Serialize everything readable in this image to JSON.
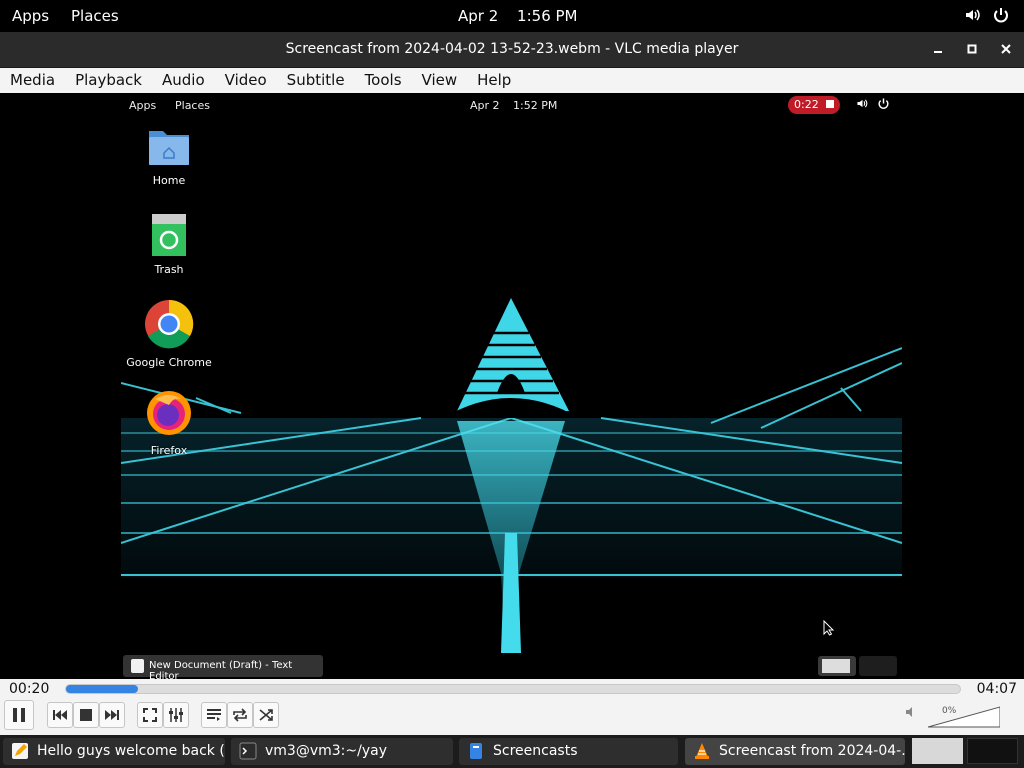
{
  "system_bar": {
    "apps": "Apps",
    "places": "Places",
    "date": "Apr 2",
    "time": "1:56 PM"
  },
  "window": {
    "title": "Screencast from 2024-04-02 13-52-23.webm - VLC media player"
  },
  "menu": [
    "Media",
    "Playback",
    "Audio",
    "Video",
    "Subtitle",
    "Tools",
    "View",
    "Help"
  ],
  "video_frame": {
    "topbar": {
      "apps": "Apps",
      "places": "Places",
      "date": "Apr 2",
      "time": "1:52 PM",
      "recording": "0:22"
    },
    "desktop_icons": [
      {
        "label": "Home",
        "icon": "home-folder-icon"
      },
      {
        "label": "Trash",
        "icon": "trash-icon"
      },
      {
        "label": "Google Chrome",
        "icon": "chrome-icon"
      },
      {
        "label": "Firefox",
        "icon": "firefox-icon"
      }
    ],
    "taskbar_item": "New Document (Draft) - Text Editor"
  },
  "player": {
    "elapsed": "00:20",
    "total": "04:07",
    "progress": 0.081,
    "volume": "0%"
  },
  "taskbar": [
    {
      "label": "Hello guys welcome back (...",
      "icon": "text-editor-icon"
    },
    {
      "label": "vm3@vm3:~/yay",
      "icon": "terminal-icon"
    },
    {
      "label": "Screencasts",
      "icon": "files-icon"
    },
    {
      "label": "Screencast from 2024-04-...",
      "icon": "vlc-icon"
    }
  ],
  "colors": {
    "accent": "#3584e4",
    "record": "#c01c28",
    "grid": "#3fd6e8"
  }
}
